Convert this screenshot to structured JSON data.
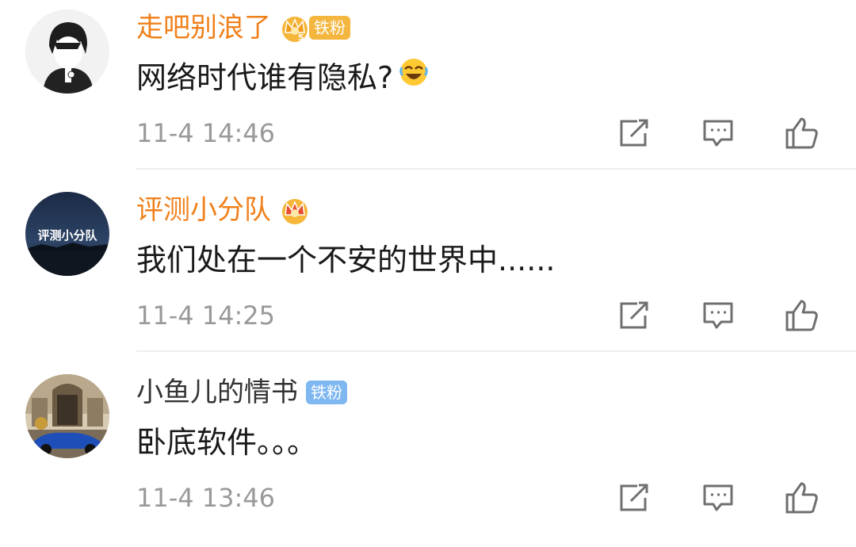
{
  "comments": [
    {
      "username": "走吧别浪了",
      "badge": "铁粉",
      "crown_level": "5",
      "text": "网络时代谁有隐私?",
      "emoji": "laugh-cry-emoji",
      "time": "11-4 14:46"
    },
    {
      "username": "评测小分队",
      "avatar_text": "评测小分队",
      "text": "我们处在一个不安的世界中......",
      "time": "11-4 14:25"
    },
    {
      "username": "小鱼儿的情书",
      "badge": "铁粉",
      "text": "卧底软件。。。",
      "time": "11-4 13:46"
    }
  ],
  "colors": {
    "vip_name": "#f0801a",
    "normal_name": "#333333",
    "time": "#999999",
    "gold_badge": "#f4b63f",
    "blue_badge": "#7fb7f1",
    "icon": "#6f6f6f"
  },
  "icons": [
    "share-icon",
    "comment-icon",
    "like-icon",
    "crown-icon"
  ]
}
